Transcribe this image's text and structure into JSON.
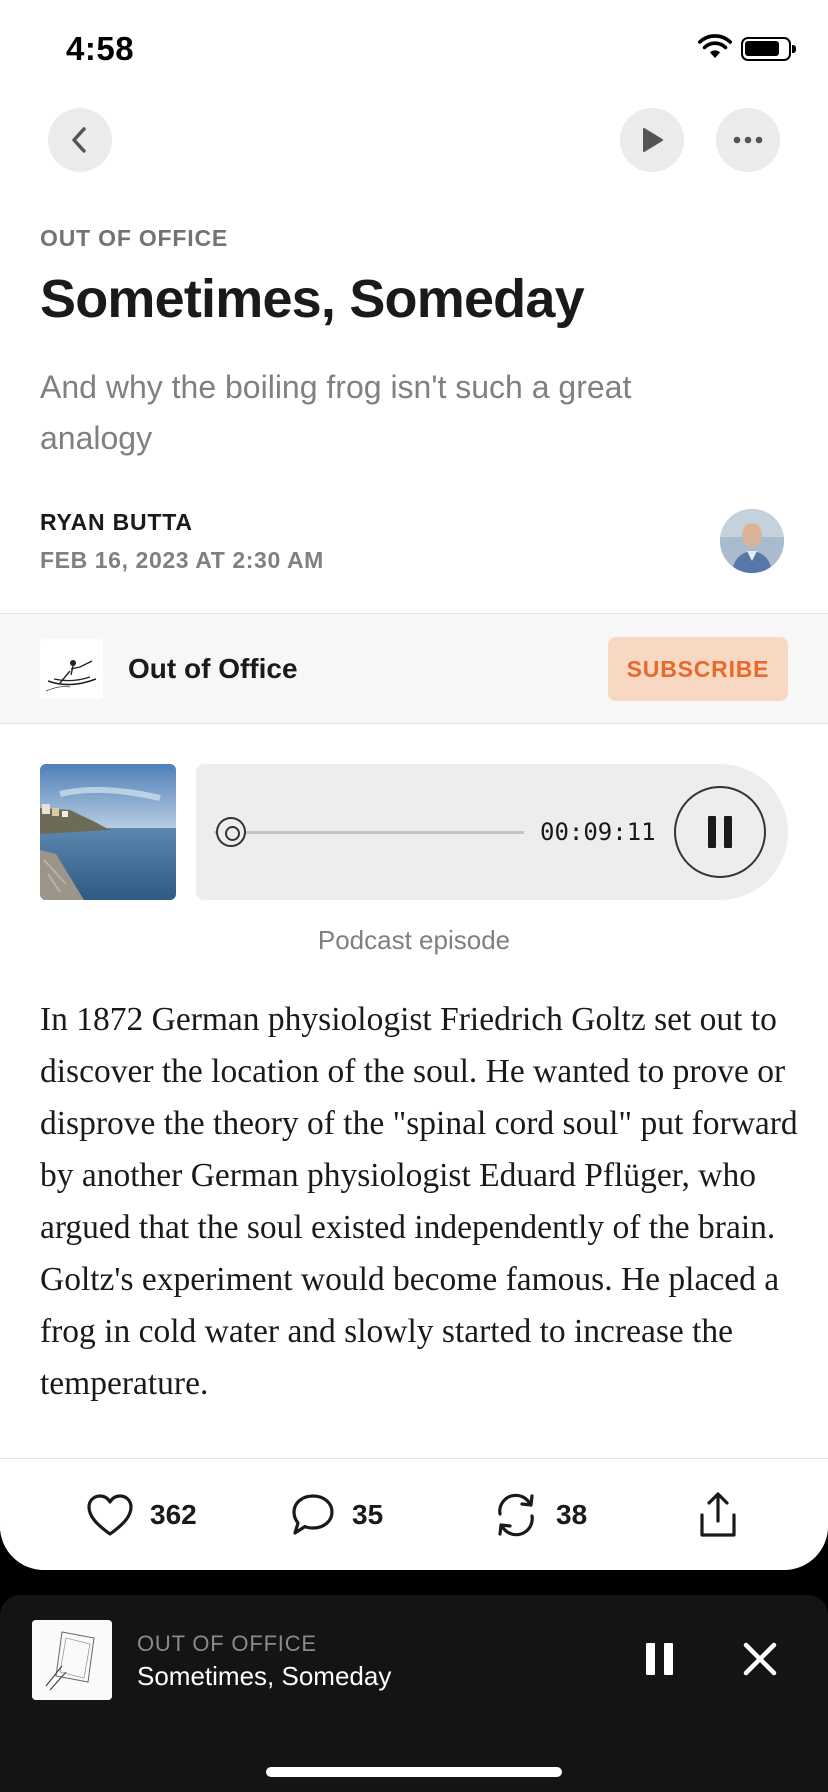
{
  "status_bar": {
    "time": "4:58"
  },
  "post": {
    "publication_kicker": "OUT OF OFFICE",
    "title": "Sometimes, Someday",
    "subtitle": "And why the boiling frog isn't such a great analogy",
    "author": "RYAN BUTTA",
    "date": "FEB 16, 2023 AT 2:30 AM"
  },
  "publication": {
    "name": "Out of Office",
    "subscribe_label": "SUBSCRIBE",
    "accent": "#e86a2a"
  },
  "player": {
    "time": "00:09:11",
    "progress": 0.02,
    "caption": "Podcast episode"
  },
  "body": "In 1872 German physiologist Friedrich Goltz set out to discover the location of the soul. He wanted to prove or disprove the theory of the \"spinal cord soul\" put forward by another German physiologist Eduard Pflüger, who argued that the soul existed independently of the brain. Goltz's experiment would become famous. He placed a frog in cold water and slowly started to increase the temperature.",
  "actions": {
    "likes": "362",
    "comments": "35",
    "restacks": "38"
  },
  "mini_player": {
    "kicker": "OUT OF OFFICE",
    "title": "Sometimes, Someday"
  },
  "icons": [
    "chevron-left-icon",
    "play-icon",
    "more-icon",
    "heart-icon",
    "comment-icon",
    "restack-icon",
    "share-icon",
    "pause-icon",
    "close-icon"
  ]
}
